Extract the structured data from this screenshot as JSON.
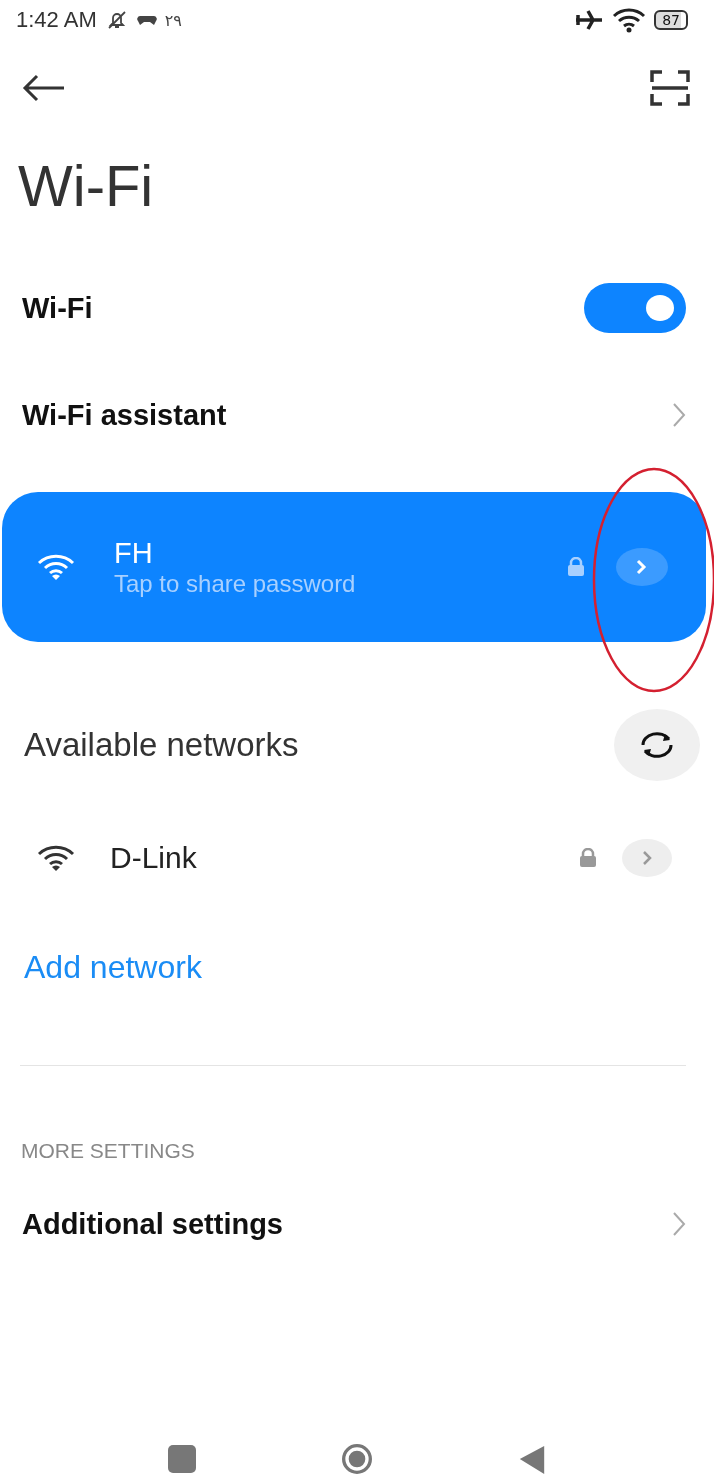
{
  "status_bar": {
    "time": "1:42 AM",
    "date": "٢٩",
    "battery": "87"
  },
  "title": "Wi-Fi",
  "wifi_toggle": {
    "label": "Wi-Fi",
    "on": true
  },
  "assistant": {
    "label": "Wi-Fi assistant"
  },
  "connected": {
    "name": "FH",
    "subtitle": "Tap to share password",
    "secured": true
  },
  "available": {
    "title": "Available networks"
  },
  "networks": [
    {
      "name": "D-Link",
      "secured": true
    }
  ],
  "add_network": "Add network",
  "more_settings": {
    "header": "MORE SETTINGS",
    "items": [
      {
        "label": "Additional settings"
      }
    ]
  }
}
